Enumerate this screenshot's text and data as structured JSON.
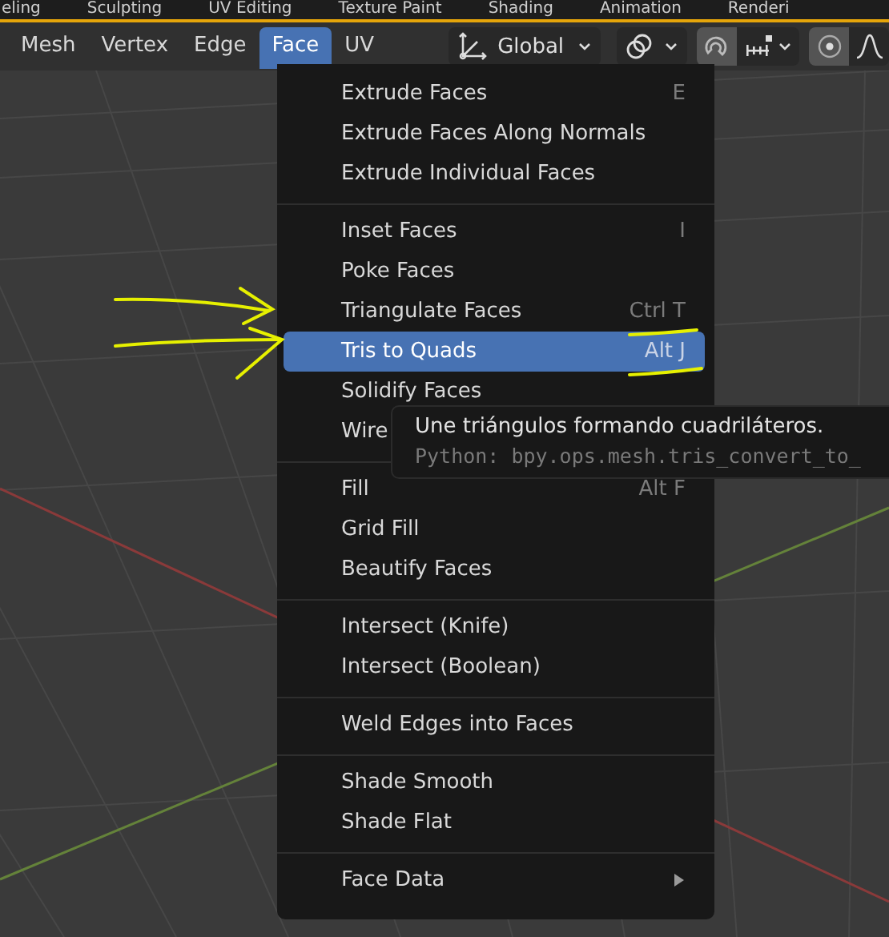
{
  "workspace_tabs": [
    "eling",
    "Sculpting",
    "UV Editing",
    "Texture Paint",
    "Shading",
    "Animation",
    "Renderi"
  ],
  "header": {
    "menus": [
      {
        "label": "Mesh",
        "selected": false
      },
      {
        "label": "Vertex",
        "selected": false
      },
      {
        "label": "Edge",
        "selected": false
      },
      {
        "label": "Face",
        "selected": true
      },
      {
        "label": "UV",
        "selected": false
      }
    ],
    "orientation": "Global",
    "snapping_on": true
  },
  "menu": {
    "sections": [
      {
        "items": [
          {
            "label": "Extrude Faces",
            "shortcut": "E",
            "selected": false
          },
          {
            "label": "Extrude Faces Along Normals",
            "selected": false
          },
          {
            "label": "Extrude Individual Faces",
            "selected": false
          }
        ]
      },
      {
        "items": [
          {
            "label": "Inset Faces",
            "shortcut": "I",
            "selected": false
          },
          {
            "label": "Poke Faces",
            "selected": false
          },
          {
            "label": "Triangulate Faces",
            "shortcut": "Ctrl T",
            "selected": false
          },
          {
            "label": "Tris to Quads",
            "shortcut": "Alt J",
            "selected": true
          },
          {
            "label": "Solidify Faces",
            "selected": false
          },
          {
            "label": "Wire",
            "selected": false
          }
        ]
      },
      {
        "items": [
          {
            "label": "Fill",
            "shortcut": "Alt F",
            "selected": false
          },
          {
            "label": "Grid Fill",
            "selected": false
          },
          {
            "label": "Beautify Faces",
            "selected": false
          }
        ]
      },
      {
        "items": [
          {
            "label": "Intersect (Knife)",
            "selected": false
          },
          {
            "label": "Intersect (Boolean)",
            "selected": false
          }
        ]
      },
      {
        "items": [
          {
            "label": "Weld Edges into Faces",
            "selected": false
          }
        ]
      },
      {
        "items": [
          {
            "label": "Shade Smooth",
            "selected": false
          },
          {
            "label": "Shade Flat",
            "selected": false
          }
        ]
      },
      {
        "items": [
          {
            "label": "Face Data",
            "submenu": true,
            "selected": false
          }
        ]
      }
    ]
  },
  "tooltip": {
    "description": "Une triángulos formando cuadriláteros.",
    "python": "Python: bpy.ops.mesh.tris_convert_to_"
  }
}
